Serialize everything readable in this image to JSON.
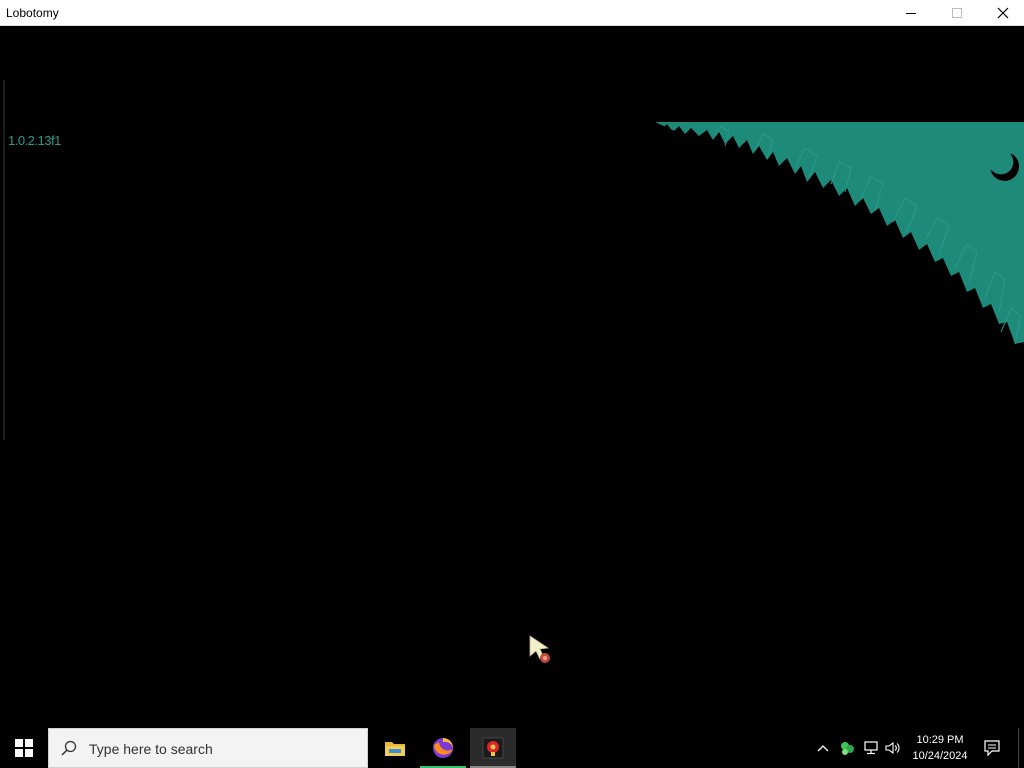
{
  "window": {
    "title": "Lobotomy"
  },
  "game": {
    "version_text": "1.0.2.13f1",
    "colors": {
      "background": "#000000",
      "teal": "#2a9b8a",
      "sky": "#1e8a7a",
      "version_text": "#2a9b8a"
    }
  },
  "taskbar": {
    "search_placeholder": "Type here to search",
    "apps": [
      {
        "name": "File Explorer",
        "icon": "folder-icon"
      },
      {
        "name": "Firefox",
        "icon": "firefox-icon"
      },
      {
        "name": "Lobotomy",
        "icon": "lobotomy-app-icon"
      }
    ],
    "tray": {
      "time": "10:29 PM",
      "date": "10/24/2024"
    }
  }
}
